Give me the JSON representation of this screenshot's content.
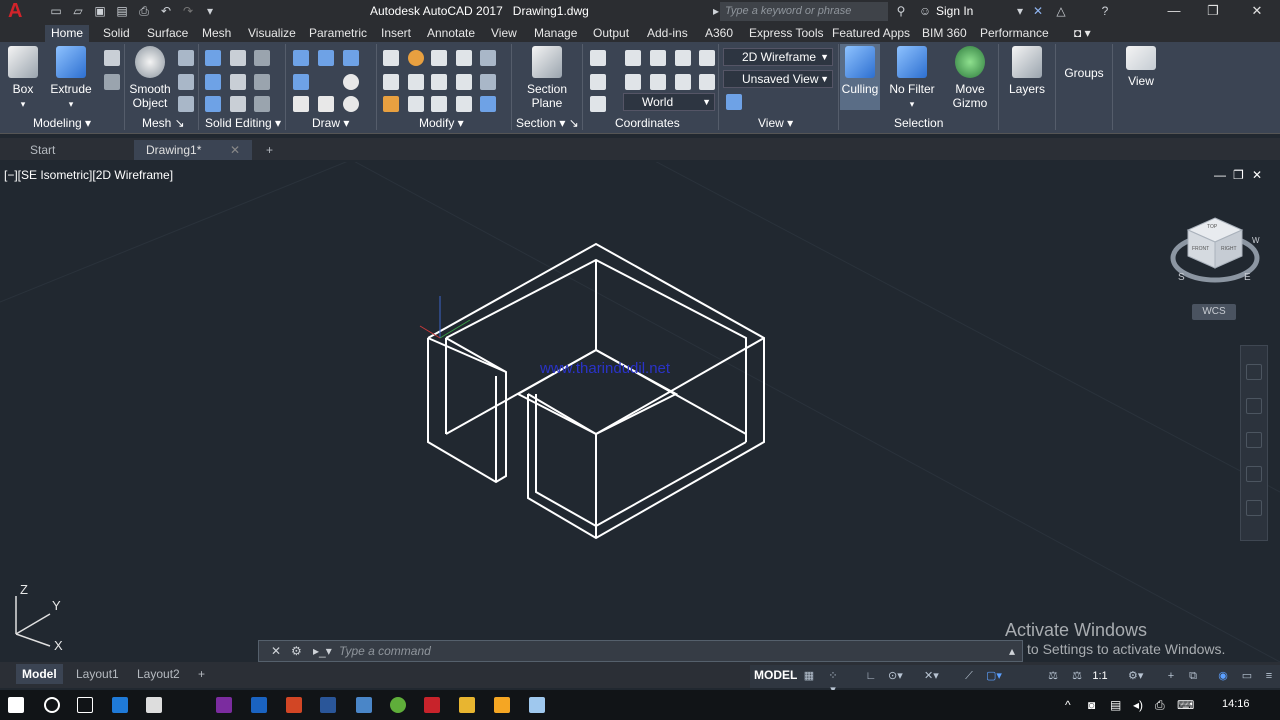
{
  "app": {
    "title": "Autodesk AutoCAD 2017",
    "file": "Drawing1.dwg",
    "logo": "A"
  },
  "search": {
    "placeholder": "Type a keyword or phrase"
  },
  "account": {
    "label": "Sign In"
  },
  "ribbon_tabs": [
    "Home",
    "Solid",
    "Surface",
    "Mesh",
    "Visualize",
    "Parametric",
    "Insert",
    "Annotate",
    "View",
    "Manage",
    "Output",
    "Add-ins",
    "A360",
    "Express Tools",
    "Featured Apps",
    "BIM 360",
    "Performance"
  ],
  "ribbon": {
    "box": "Box",
    "extrude": "Extrude",
    "smooth": "Smooth",
    "object": "Object",
    "section": "Section",
    "plane": "Plane",
    "culling": "Culling",
    "nofilter": "No Filter",
    "move": "Move",
    "gizmo": "Gizmo",
    "layers": "Layers",
    "groups": "Groups",
    "view": "View",
    "visual_style": "2D Wireframe",
    "named_view": "Unsaved View",
    "ucs": "World",
    "panels": {
      "modeling": "Modeling",
      "mesh": "Mesh",
      "solid_editing": "Solid Editing",
      "draw": "Draw",
      "modify": "Modify",
      "section": "Section",
      "coordinates": "Coordinates",
      "view": "View",
      "selection": "Selection"
    }
  },
  "file_tabs": {
    "start": "Start",
    "drawing": "Drawing1*"
  },
  "viewport": {
    "label": "[−][SE Isometric][2D Wireframe]",
    "watermark_text": "www.tharindudil.net"
  },
  "viewcube": {
    "wcs": "WCS",
    "top": "TOP",
    "front": "FRONT",
    "right": "RIGHT",
    "s": "S",
    "e": "E",
    "w": "W"
  },
  "axis": {
    "x": "X",
    "y": "Y",
    "z": "Z"
  },
  "activation": {
    "line1": "Activate Windows",
    "line2": "to Settings to activate Windows."
  },
  "command": {
    "placeholder": "Type  a  command"
  },
  "layouts": [
    "Model",
    "Layout1",
    "Layout2"
  ],
  "status": {
    "model": "MODEL",
    "scale": "1:1"
  },
  "clock": "14:16",
  "colors": {
    "ribbon": "#3b4453",
    "viewport": "#212830",
    "accent": "#3d7bd4",
    "logo": "#d2232a"
  }
}
